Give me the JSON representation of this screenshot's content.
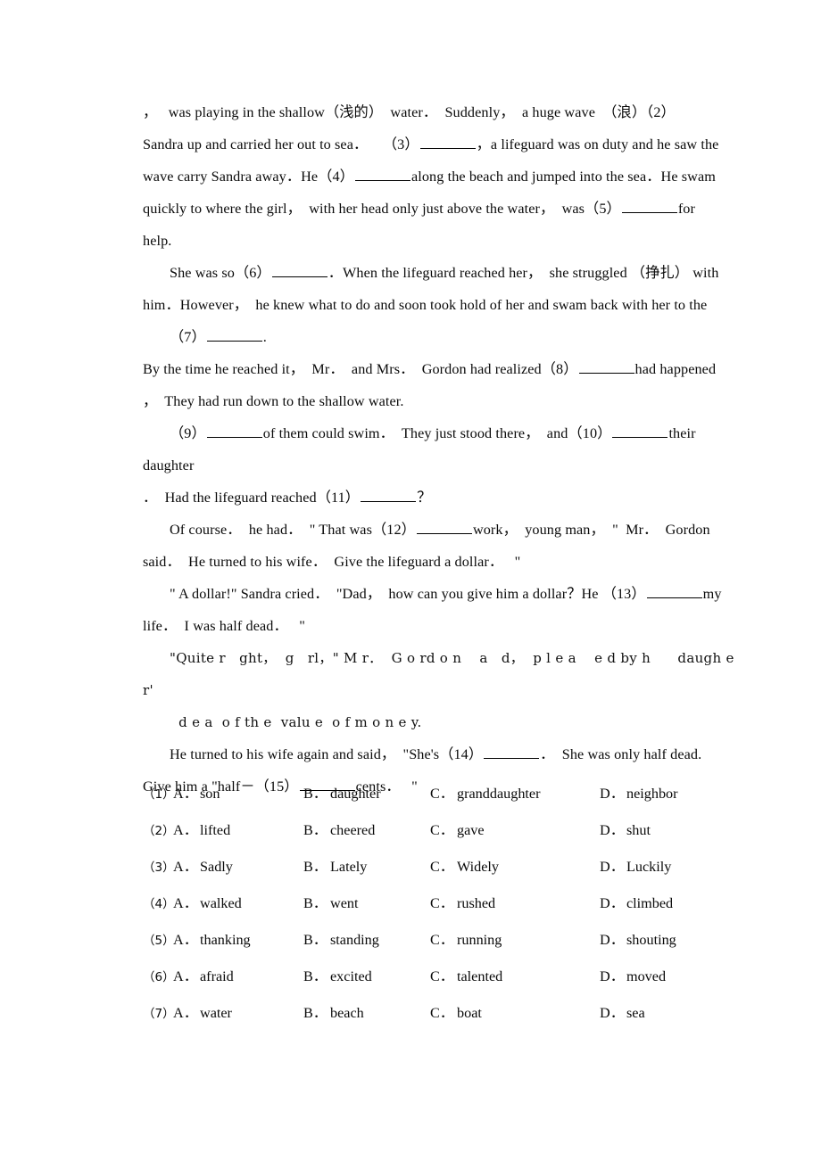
{
  "passage": {
    "lines": [
      {
        "id": "l1",
        "indent": false,
        "degraded": false,
        "text": "，   was playing in the shallow（浅的）  water．  Suddenly，  a huge wave  （浪）（2）"
      },
      {
        "id": "l2",
        "indent": false,
        "degraded": false,
        "pre": "Sandra up and carried her out to sea．    （3）",
        "blank": "md",
        "post": "，a lifeguard was on duty and he saw the"
      },
      {
        "id": "l3",
        "indent": false,
        "degraded": false,
        "pre": "wave carry Sandra away．He（4）",
        "blank": "md",
        "post": "along the beach and jumped into the sea．He swam"
      },
      {
        "id": "l4",
        "indent": false,
        "degraded": false,
        "pre": "quickly to where the girl，  with her head only just above the water，  was（5）",
        "blank": "md",
        "post": "for"
      },
      {
        "id": "l5",
        "indent": false,
        "degraded": false,
        "text": "help."
      },
      {
        "id": "l6",
        "indent": true,
        "degraded": false,
        "pre": "She was so（6）",
        "blank": "md",
        "post": "．When the lifeguard reached her，  she struggled （挣扎） with"
      },
      {
        "id": "l7",
        "indent": false,
        "degraded": false,
        "text": "him．However，  he knew what to do and soon took hold of her and swam back with her to the"
      },
      {
        "id": "l8",
        "indent": true,
        "degraded": false,
        "pre": "（7）",
        "blank": "md",
        "post": "."
      },
      {
        "id": "l9",
        "indent": false,
        "degraded": false,
        "pre": "By the time he reached it，  Mr．  and Mrs．  Gordon had realized（8）",
        "blank": "md",
        "post": "had happened"
      },
      {
        "id": "l10",
        "indent": false,
        "degraded": false,
        "text": "，  They had run down to the shallow water."
      },
      {
        "id": "l11",
        "indent": true,
        "degraded": false,
        "pre": "（9）",
        "blank": "md",
        "mid": "of them could swim．  They just stood there，  and（10）",
        "blank2": "md",
        "post": "their daughter"
      },
      {
        "id": "l12",
        "indent": false,
        "degraded": false,
        "pre": "．  Had the lifeguard reached（11）",
        "blank": "md",
        "post": "？"
      },
      {
        "id": "l13",
        "indent": true,
        "degraded": false,
        "pre": "Of course．  he had．  \" That was（12）",
        "blank": "md",
        "post": "work，  young man，  \"  Mr．  Gordon"
      },
      {
        "id": "l14",
        "indent": false,
        "degraded": false,
        "text": "said．  He turned to his wife．  Give the lifeguard a dollar．   \""
      },
      {
        "id": "l15",
        "indent": true,
        "degraded": false,
        "pre": "\" A dollar!\" Sandra cried．  \"Dad，  how can you give him a dollar？He （13）",
        "blank": "md",
        "post": "my"
      },
      {
        "id": "l16",
        "indent": false,
        "degraded": false,
        "text": "life．  I was half dead．   \""
      },
      {
        "id": "l17",
        "indent": true,
        "degraded": true,
        "text": "\"Quite r   ght，  g   rl，\" M r．  G o rd o n    a   d，  p l e a    e d by h      daugh e r'"
      },
      {
        "id": "l18",
        "indent": true,
        "degraded": true,
        "text": "  d e a  o f th e  valu e  o f m o n e y."
      },
      {
        "id": "l19",
        "indent": true,
        "degraded": false,
        "pre": "He turned to his wife again and said，  \"She's（14）",
        "blank": "md",
        "post": "．  She was only half dead."
      },
      {
        "id": "l20",
        "indent": false,
        "degraded": false,
        "pre": "Give him a \"half－（15）",
        "blank": "md",
        "post": "cents．   \""
      }
    ]
  },
  "options": {
    "letters": [
      "A．",
      "B．",
      "C．",
      "D．"
    ],
    "rows": [
      {
        "num": "（1）",
        "choices": [
          "son",
          "daughter",
          "granddaughter",
          "neighbor"
        ]
      },
      {
        "num": "（2）",
        "choices": [
          "lifted",
          "cheered",
          "gave",
          "shut"
        ]
      },
      {
        "num": "（3）",
        "choices": [
          "Sadly",
          "Lately",
          "Widely",
          "Luckily"
        ]
      },
      {
        "num": "（4）",
        "choices": [
          "walked",
          "went",
          "rushed",
          "climbed"
        ]
      },
      {
        "num": "（5）",
        "choices": [
          "thanking",
          "standing",
          "running",
          "shouting"
        ]
      },
      {
        "num": "（6）",
        "choices": [
          "afraid",
          "excited",
          "talented",
          "moved"
        ]
      },
      {
        "num": "（7）",
        "choices": [
          "water",
          "beach",
          "boat",
          "sea"
        ]
      }
    ]
  }
}
